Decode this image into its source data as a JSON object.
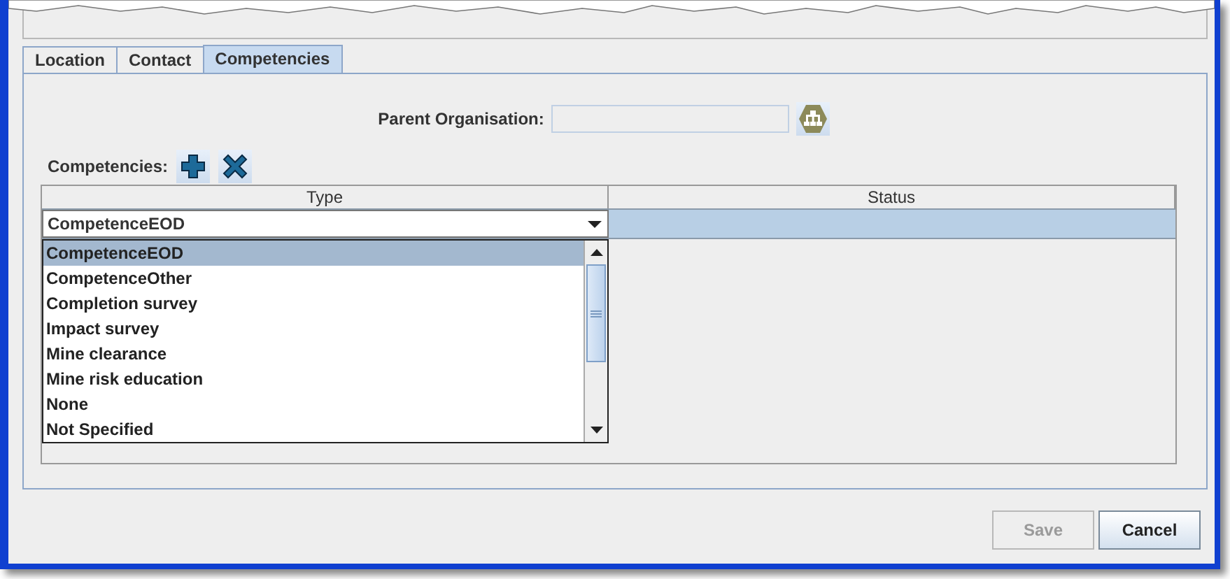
{
  "tabs": [
    {
      "label": "Location",
      "selected": false
    },
    {
      "label": "Contact",
      "selected": false
    },
    {
      "label": "Competencies",
      "selected": true
    }
  ],
  "parent_organisation": {
    "label": "Parent Organisation:"
  },
  "competencies": {
    "label": "Competencies:"
  },
  "table": {
    "columns": [
      "Type",
      "Status"
    ],
    "rows": [
      {
        "type": "CompetenceEOD",
        "selected": true
      }
    ]
  },
  "dropdown": {
    "expanded": true,
    "options": [
      {
        "label": "CompetenceEOD",
        "selected": true
      },
      {
        "label": "CompetenceOther",
        "selected": false
      },
      {
        "label": "Completion survey",
        "selected": false
      },
      {
        "label": "Impact survey",
        "selected": false
      },
      {
        "label": "Mine clearance",
        "selected": false
      },
      {
        "label": "Mine risk education",
        "selected": false
      },
      {
        "label": "None",
        "selected": false
      },
      {
        "label": "Not Specified",
        "selected": false
      }
    ]
  },
  "buttons": [
    {
      "label": "Save",
      "disabled": true
    },
    {
      "label": "Cancel",
      "disabled": false
    }
  ]
}
